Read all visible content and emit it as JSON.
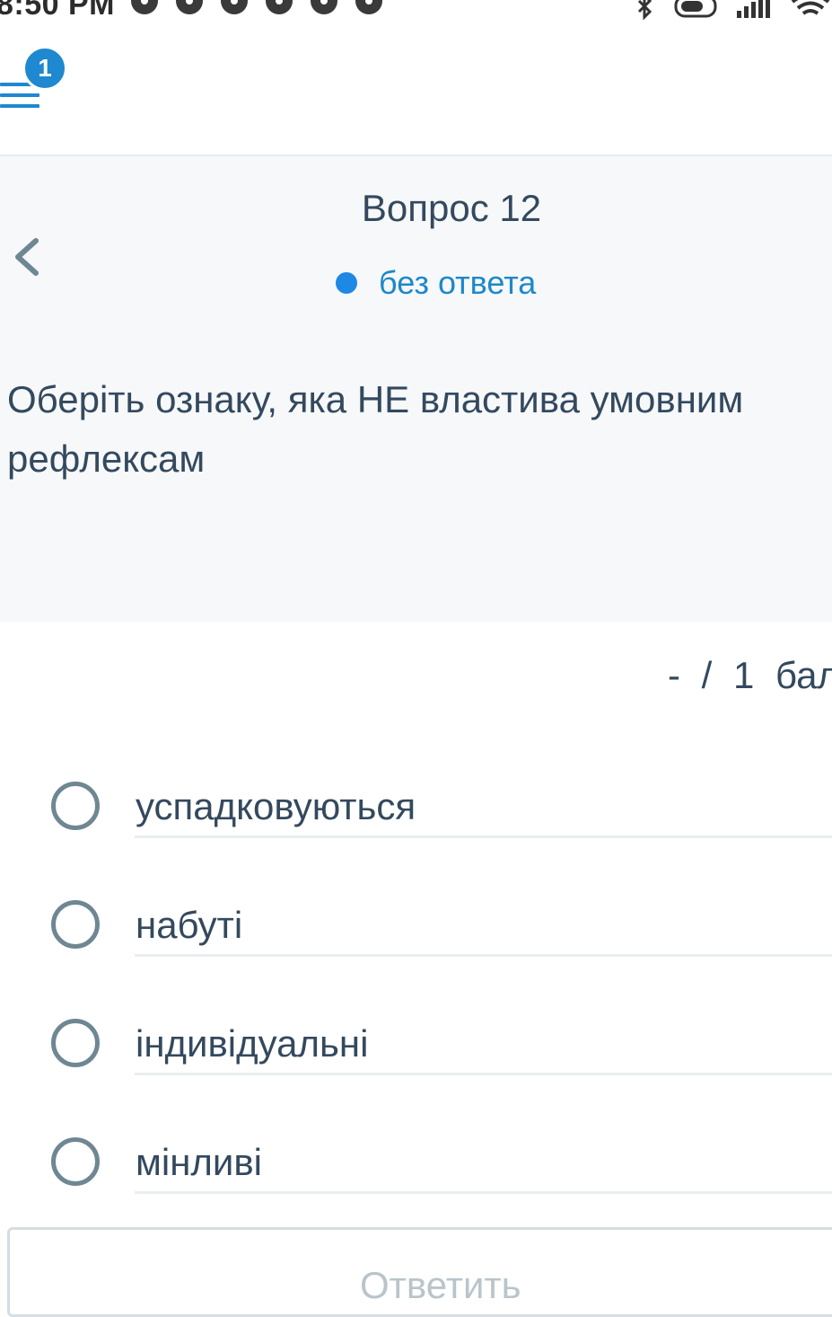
{
  "status_bar": {
    "time": "8:50 PM"
  },
  "header": {
    "menu_badge": "1"
  },
  "question": {
    "title": "Вопрос 12",
    "status": "без ответа",
    "text": "Оберіть ознаку, яка НЕ властива умовним рефлексам",
    "points": "- / 1 бал"
  },
  "options": [
    {
      "label": "успадковуються",
      "selected": false
    },
    {
      "label": "набуті",
      "selected": false
    },
    {
      "label": "індивідуальні",
      "selected": false
    },
    {
      "label": "мінливі",
      "selected": false
    }
  ],
  "submit": {
    "label": "Ответить"
  },
  "colors": {
    "accent": "#1e88d0",
    "text": "#34495e",
    "radio_border": "#6f8793",
    "card_bg": "#f6f8fa",
    "disabled_text": "#b9c4cb"
  }
}
